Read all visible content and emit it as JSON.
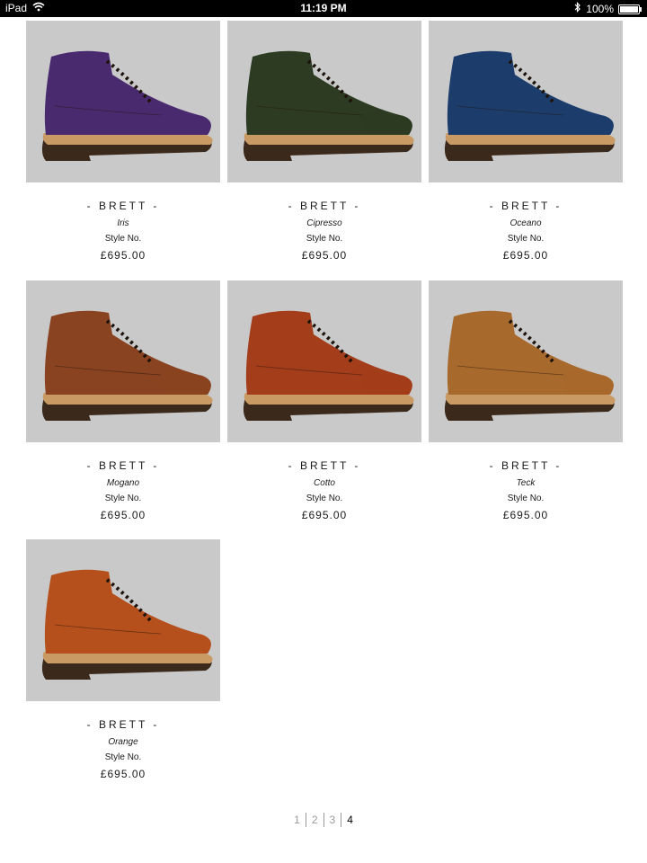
{
  "status_bar": {
    "device": "iPad",
    "time": "11:19 PM",
    "battery_text": "100%",
    "battery_level": 1.0
  },
  "colors": {
    "image_background": "#c9c9ca",
    "leather": {
      "Iris": "#4a2a6e",
      "Cipresso": "#2d3b22",
      "Oceano": "#1c3c6c",
      "Mogano": "#8a4320",
      "Cotto": "#a33d1a",
      "Teck": "#a8692c",
      "Orange": "#b5501c"
    }
  },
  "products": [
    {
      "name": "- BRETT -",
      "color": "Iris",
      "style_label": "Style No.",
      "price": "£695.00",
      "image_icon": "boot-icon"
    },
    {
      "name": "- BRETT -",
      "color": "Cipresso",
      "style_label": "Style No.",
      "price": "£695.00",
      "image_icon": "boot-icon"
    },
    {
      "name": "- BRETT -",
      "color": "Oceano",
      "style_label": "Style No.",
      "price": "£695.00",
      "image_icon": "boot-icon"
    },
    {
      "name": "- BRETT -",
      "color": "Mogano",
      "style_label": "Style No.",
      "price": "£695.00",
      "image_icon": "boot-icon"
    },
    {
      "name": "- BRETT -",
      "color": "Cotto",
      "style_label": "Style No.",
      "price": "£695.00",
      "image_icon": "boot-icon"
    },
    {
      "name": "- BRETT -",
      "color": "Teck",
      "style_label": "Style No.",
      "price": "£695.00",
      "image_icon": "boot-icon"
    },
    {
      "name": "- BRETT -",
      "color": "Orange",
      "style_label": "Style No.",
      "price": "£695.00",
      "image_icon": "boot-icon"
    }
  ],
  "pagination": {
    "pages": [
      "1",
      "2",
      "3",
      "4"
    ],
    "current": "4"
  }
}
